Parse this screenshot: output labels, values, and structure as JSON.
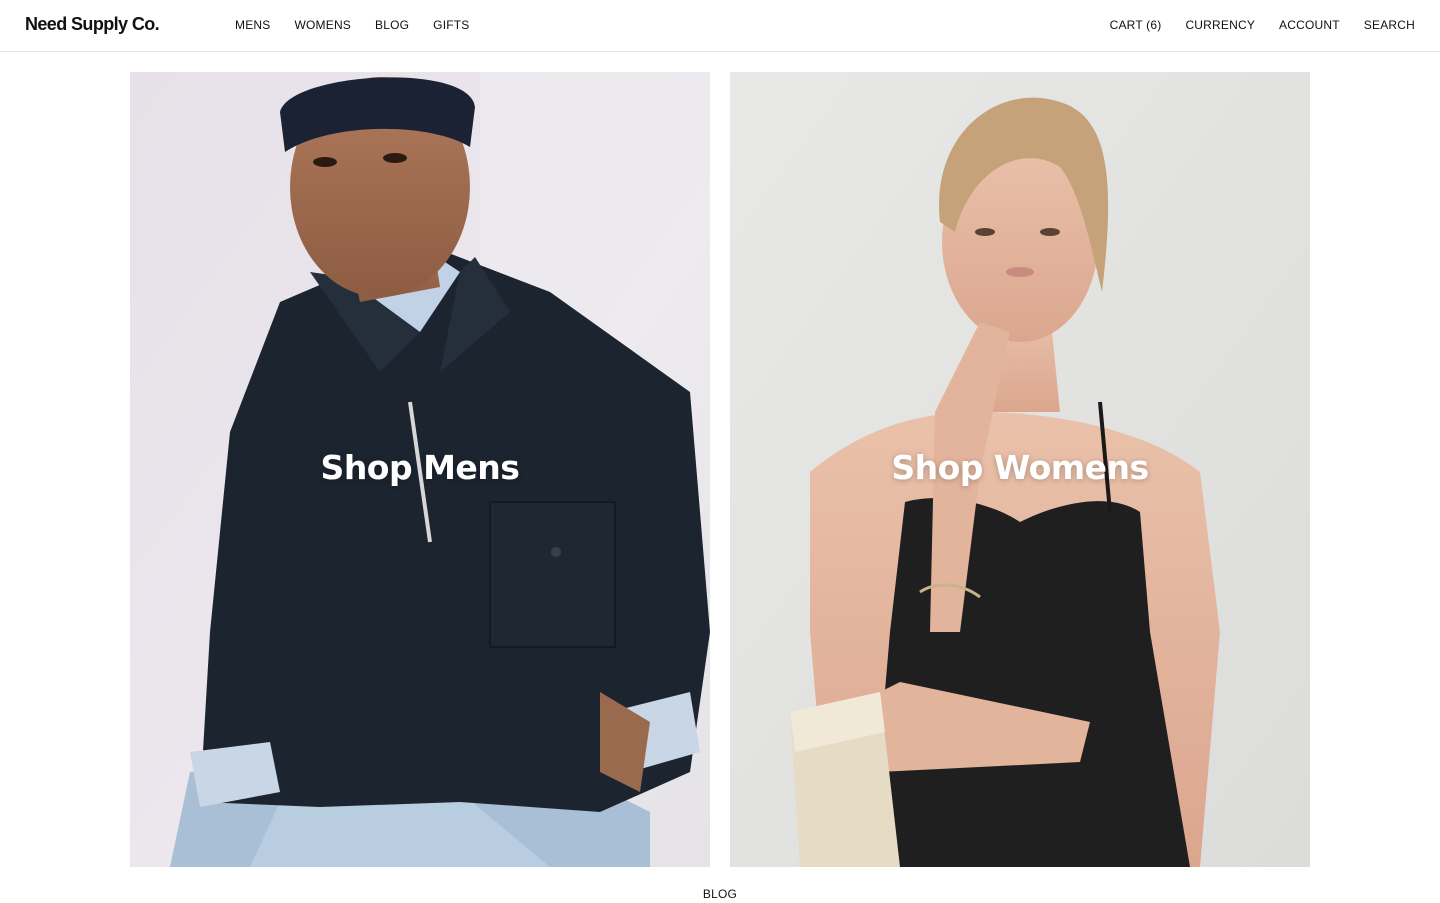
{
  "header": {
    "logo": "Need Supply Co.",
    "nav_left": [
      {
        "label": "MENS"
      },
      {
        "label": "WOMENS"
      },
      {
        "label": "BLOG"
      },
      {
        "label": "GIFTS"
      }
    ],
    "nav_right": [
      {
        "label": "CART (6)"
      },
      {
        "label": "CURRENCY"
      },
      {
        "label": "ACCOUNT"
      },
      {
        "label": "SEARCH"
      }
    ]
  },
  "panels": {
    "mens": {
      "title": "Shop Mens"
    },
    "womens": {
      "title": "Shop Womens"
    }
  },
  "footer": {
    "link": "BLOG"
  },
  "colors": {
    "text": "#111111",
    "background": "#ffffff",
    "overlay_text": "#ffffff"
  }
}
